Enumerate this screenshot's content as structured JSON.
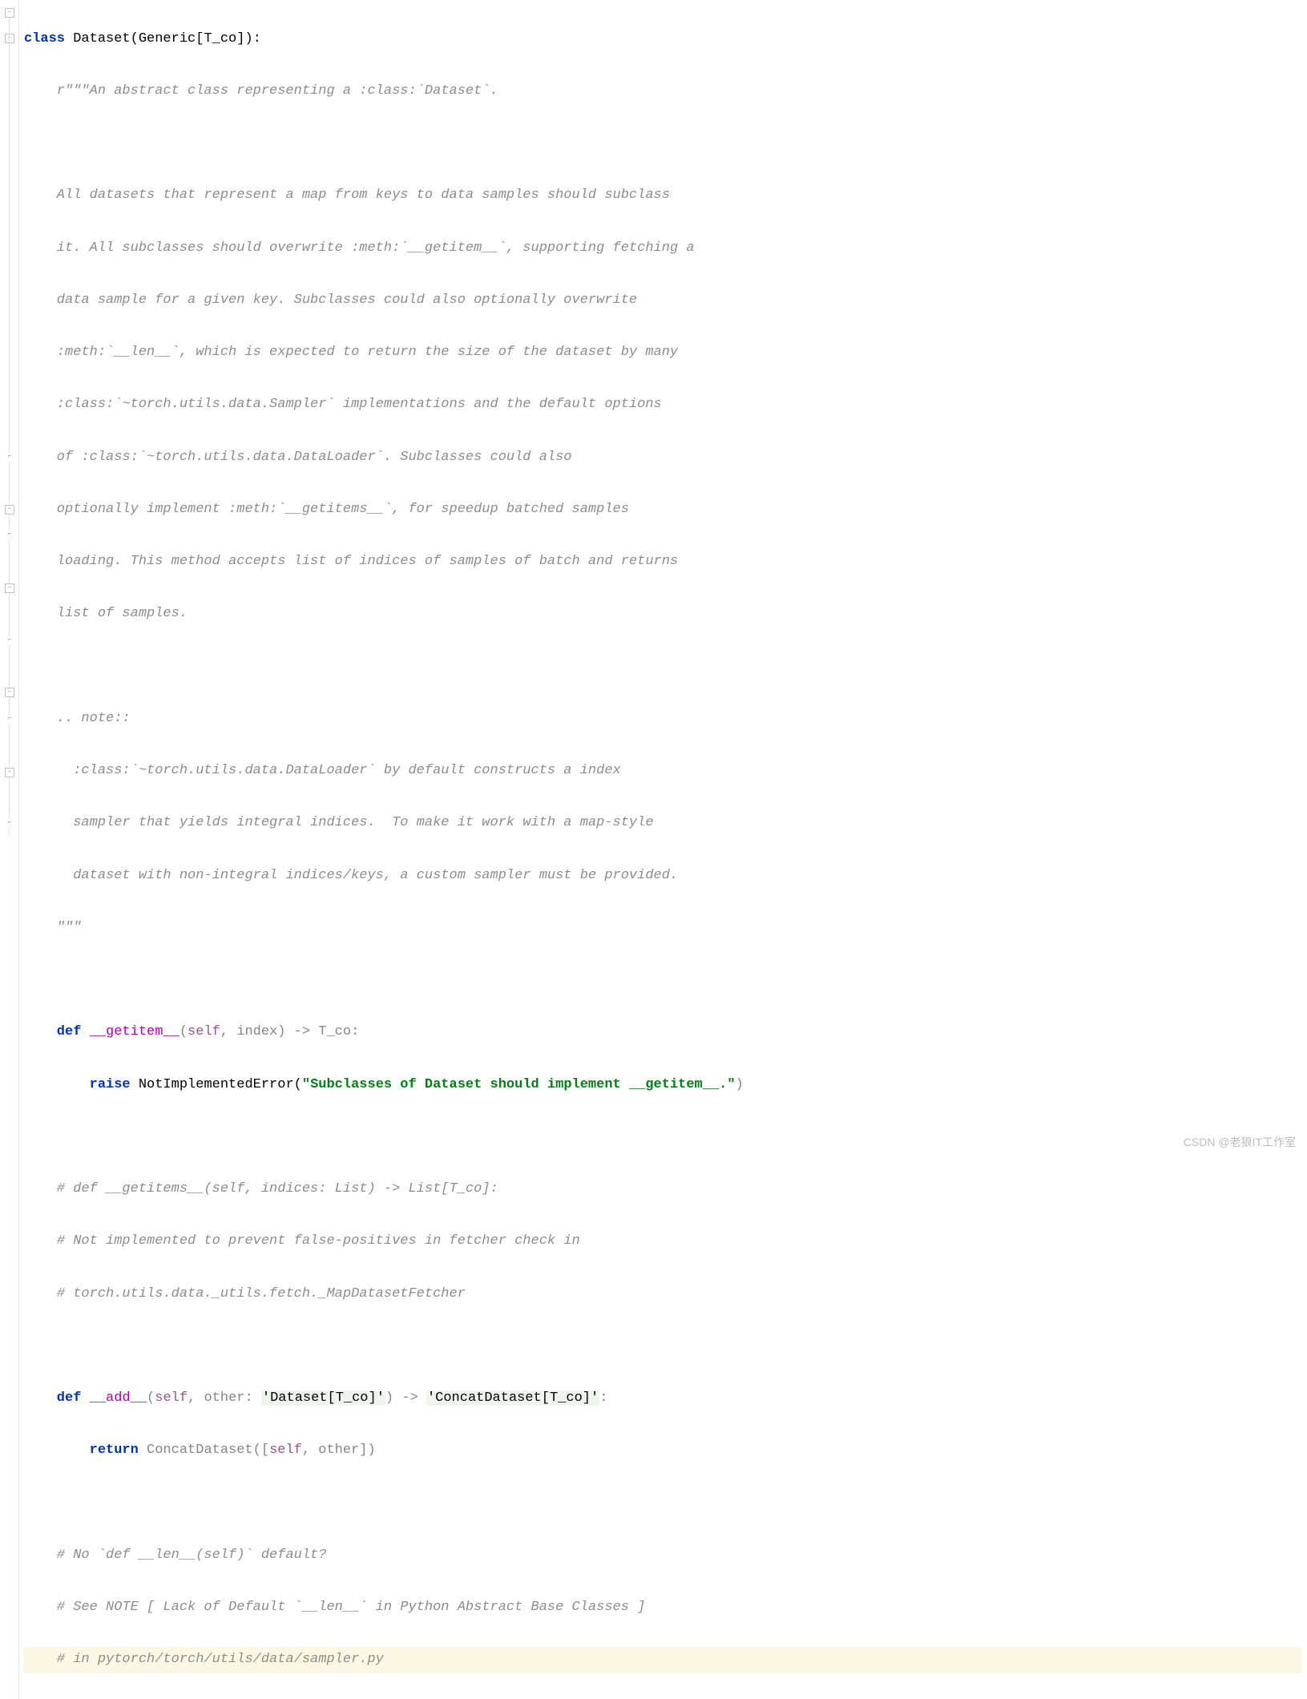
{
  "code": {
    "l1_kw": "class",
    "l1_name": " Dataset(Generic[T_co]):",
    "l2": "    r\"\"\"An abstract class representing a :class:`Dataset`.",
    "l3": "",
    "l4": "    All datasets that represent a map from keys to data samples should subclass",
    "l5": "    it. All subclasses should overwrite :meth:`__getitem__`, supporting fetching a",
    "l6": "    data sample for a given key. Subclasses could also optionally overwrite",
    "l7": "    :meth:`__len__`, which is expected to return the size of the dataset by many",
    "l8": "    :class:`~torch.utils.data.Sampler` implementations and the default options",
    "l9": "    of :class:`~torch.utils.data.DataLoader`. Subclasses could also",
    "l10": "    optionally implement :meth:`__getitems__`, for speedup batched samples",
    "l11": "    loading. This method accepts list of indices of samples of batch and returns",
    "l12": "    list of samples.",
    "l13": "",
    "l14": "    .. note::",
    "l15": "      :class:`~torch.utils.data.DataLoader` by default constructs a index",
    "l16": "      sampler that yields integral indices.  To make it work with a map-style",
    "l17": "      dataset with non-integral indices/keys, a custom sampler must be provided.",
    "l18": "    \"\"\"",
    "l19": "",
    "l20_def": "    def ",
    "l20_name": "__getitem__",
    "l20_sig_open": "(",
    "l20_self": "self",
    "l20_sig_rest": ", index) -> T_co:",
    "l21_kw": "        raise ",
    "l21_cls": "NotImplementedError(",
    "l21_str": "\"Subclasses of Dataset should implement __getitem__.\"",
    "l21_close": ")",
    "l22": "",
    "l23": "    # def __getitems__(self, indices: List) -> List[T_co]:",
    "l24": "    # Not implemented to prevent false-positives in fetcher check in",
    "l25": "    # torch.utils.data._utils.fetch._MapDatasetFetcher",
    "l26": "",
    "l27_def": "    def ",
    "l27_name": "__add__",
    "l27_sig_open": "(",
    "l27_self": "self",
    "l27_sig_mid": ", other: ",
    "l27_hint1": "'Dataset[T_co]'",
    "l27_sig_mid2": ") -> ",
    "l27_hint2": "'ConcatDataset[T_co]'",
    "l27_sig_end": ":",
    "l28_kw": "        return ",
    "l28_call": "ConcatDataset([",
    "l28_self": "self",
    "l28_rest": ", other])",
    "l29": "",
    "l30": "    # No `def __len__(self)` default?",
    "l31": "    # See NOTE [ Lack of Default `__len__` in Python Abstract Base Classes ]",
    "l32": "    # in pytorch/torch/utils/data/sampler.py"
  },
  "watermark": "CSDN @老狼IT工作室"
}
